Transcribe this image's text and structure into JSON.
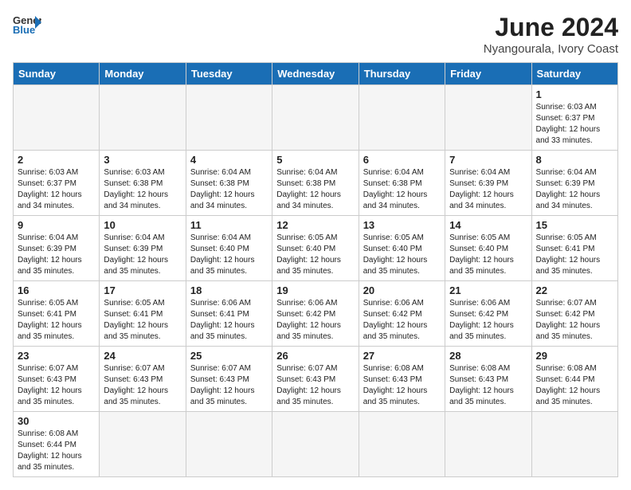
{
  "header": {
    "logo_general": "General",
    "logo_blue": "Blue",
    "month_title": "June 2024",
    "location": "Nyangourala, Ivory Coast"
  },
  "weekdays": [
    "Sunday",
    "Monday",
    "Tuesday",
    "Wednesday",
    "Thursday",
    "Friday",
    "Saturday"
  ],
  "weeks": [
    [
      {
        "day": "",
        "info": ""
      },
      {
        "day": "",
        "info": ""
      },
      {
        "day": "",
        "info": ""
      },
      {
        "day": "",
        "info": ""
      },
      {
        "day": "",
        "info": ""
      },
      {
        "day": "",
        "info": ""
      },
      {
        "day": "1",
        "info": "Sunrise: 6:03 AM\nSunset: 6:37 PM\nDaylight: 12 hours\nand 33 minutes."
      }
    ],
    [
      {
        "day": "2",
        "info": "Sunrise: 6:03 AM\nSunset: 6:37 PM\nDaylight: 12 hours\nand 34 minutes."
      },
      {
        "day": "3",
        "info": "Sunrise: 6:03 AM\nSunset: 6:38 PM\nDaylight: 12 hours\nand 34 minutes."
      },
      {
        "day": "4",
        "info": "Sunrise: 6:04 AM\nSunset: 6:38 PM\nDaylight: 12 hours\nand 34 minutes."
      },
      {
        "day": "5",
        "info": "Sunrise: 6:04 AM\nSunset: 6:38 PM\nDaylight: 12 hours\nand 34 minutes."
      },
      {
        "day": "6",
        "info": "Sunrise: 6:04 AM\nSunset: 6:38 PM\nDaylight: 12 hours\nand 34 minutes."
      },
      {
        "day": "7",
        "info": "Sunrise: 6:04 AM\nSunset: 6:39 PM\nDaylight: 12 hours\nand 34 minutes."
      },
      {
        "day": "8",
        "info": "Sunrise: 6:04 AM\nSunset: 6:39 PM\nDaylight: 12 hours\nand 34 minutes."
      }
    ],
    [
      {
        "day": "9",
        "info": "Sunrise: 6:04 AM\nSunset: 6:39 PM\nDaylight: 12 hours\nand 35 minutes."
      },
      {
        "day": "10",
        "info": "Sunrise: 6:04 AM\nSunset: 6:39 PM\nDaylight: 12 hours\nand 35 minutes."
      },
      {
        "day": "11",
        "info": "Sunrise: 6:04 AM\nSunset: 6:40 PM\nDaylight: 12 hours\nand 35 minutes."
      },
      {
        "day": "12",
        "info": "Sunrise: 6:05 AM\nSunset: 6:40 PM\nDaylight: 12 hours\nand 35 minutes."
      },
      {
        "day": "13",
        "info": "Sunrise: 6:05 AM\nSunset: 6:40 PM\nDaylight: 12 hours\nand 35 minutes."
      },
      {
        "day": "14",
        "info": "Sunrise: 6:05 AM\nSunset: 6:40 PM\nDaylight: 12 hours\nand 35 minutes."
      },
      {
        "day": "15",
        "info": "Sunrise: 6:05 AM\nSunset: 6:41 PM\nDaylight: 12 hours\nand 35 minutes."
      }
    ],
    [
      {
        "day": "16",
        "info": "Sunrise: 6:05 AM\nSunset: 6:41 PM\nDaylight: 12 hours\nand 35 minutes."
      },
      {
        "day": "17",
        "info": "Sunrise: 6:05 AM\nSunset: 6:41 PM\nDaylight: 12 hours\nand 35 minutes."
      },
      {
        "day": "18",
        "info": "Sunrise: 6:06 AM\nSunset: 6:41 PM\nDaylight: 12 hours\nand 35 minutes."
      },
      {
        "day": "19",
        "info": "Sunrise: 6:06 AM\nSunset: 6:42 PM\nDaylight: 12 hours\nand 35 minutes."
      },
      {
        "day": "20",
        "info": "Sunrise: 6:06 AM\nSunset: 6:42 PM\nDaylight: 12 hours\nand 35 minutes."
      },
      {
        "day": "21",
        "info": "Sunrise: 6:06 AM\nSunset: 6:42 PM\nDaylight: 12 hours\nand 35 minutes."
      },
      {
        "day": "22",
        "info": "Sunrise: 6:07 AM\nSunset: 6:42 PM\nDaylight: 12 hours\nand 35 minutes."
      }
    ],
    [
      {
        "day": "23",
        "info": "Sunrise: 6:07 AM\nSunset: 6:43 PM\nDaylight: 12 hours\nand 35 minutes."
      },
      {
        "day": "24",
        "info": "Sunrise: 6:07 AM\nSunset: 6:43 PM\nDaylight: 12 hours\nand 35 minutes."
      },
      {
        "day": "25",
        "info": "Sunrise: 6:07 AM\nSunset: 6:43 PM\nDaylight: 12 hours\nand 35 minutes."
      },
      {
        "day": "26",
        "info": "Sunrise: 6:07 AM\nSunset: 6:43 PM\nDaylight: 12 hours\nand 35 minutes."
      },
      {
        "day": "27",
        "info": "Sunrise: 6:08 AM\nSunset: 6:43 PM\nDaylight: 12 hours\nand 35 minutes."
      },
      {
        "day": "28",
        "info": "Sunrise: 6:08 AM\nSunset: 6:43 PM\nDaylight: 12 hours\nand 35 minutes."
      },
      {
        "day": "29",
        "info": "Sunrise: 6:08 AM\nSunset: 6:44 PM\nDaylight: 12 hours\nand 35 minutes."
      }
    ],
    [
      {
        "day": "30",
        "info": "Sunrise: 6:08 AM\nSunset: 6:44 PM\nDaylight: 12 hours\nand 35 minutes."
      },
      {
        "day": "",
        "info": ""
      },
      {
        "day": "",
        "info": ""
      },
      {
        "day": "",
        "info": ""
      },
      {
        "day": "",
        "info": ""
      },
      {
        "day": "",
        "info": ""
      },
      {
        "day": "",
        "info": ""
      }
    ]
  ]
}
